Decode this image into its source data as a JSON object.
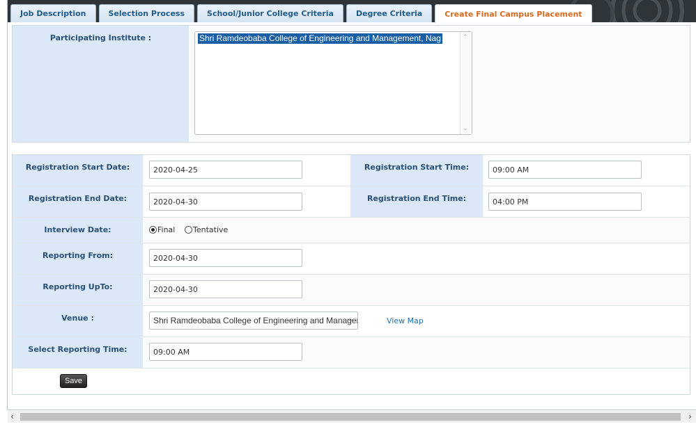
{
  "tabs": [
    {
      "label": "Job Description"
    },
    {
      "label": "Selection Process"
    },
    {
      "label": "School/Junior College Criteria"
    },
    {
      "label": "Degree Criteria"
    },
    {
      "label": "Create Final Campus Placement"
    }
  ],
  "active_tab": "Create Final Campus Placement",
  "institute": {
    "label": "Participating Institute :",
    "options": [
      "Shri Ramdeobaba College of Engineering and Management, Nag"
    ]
  },
  "form": {
    "reg_start_date": {
      "label": "Registration Start Date:",
      "value": "2020-04-25"
    },
    "reg_start_time": {
      "label": "Registration Start Time:",
      "value": "09:00 AM"
    },
    "reg_end_date": {
      "label": "Registration End Date:",
      "value": "2020-04-30"
    },
    "reg_end_time": {
      "label": "Registration End Time:",
      "value": "04:00 PM"
    },
    "interview_date": {
      "label": "Interview Date:",
      "option_final": "Final",
      "option_tentative": "Tentative",
      "selected": "Final"
    },
    "reporting_from": {
      "label": "Reporting From:",
      "value": "2020-04-30"
    },
    "reporting_upto": {
      "label": "Reporting UpTo:",
      "value": "2020-04-30"
    },
    "venue": {
      "label": "Venue :",
      "value": "Shri Ramdeobaba College of Engineering and Management",
      "view_map": "View Map"
    },
    "reporting_time": {
      "label": "Select Reporting Time:",
      "value": "09:00 AM"
    }
  },
  "actions": {
    "save": "Save"
  },
  "colors": {
    "tab_active_text": "#d9691e",
    "tab_text": "#1f5a8a",
    "label_bg": "#dbe8f8",
    "selection": "#1a5fa3"
  }
}
